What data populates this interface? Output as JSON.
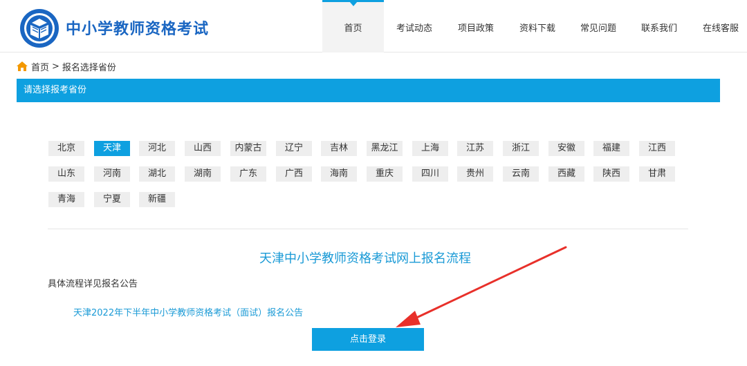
{
  "header": {
    "site_title": "中小学教师资格考试",
    "logo_icon": "education-book-seal-icon",
    "nav": [
      {
        "label": "首页",
        "active": true
      },
      {
        "label": "考试动态"
      },
      {
        "label": "项目政策"
      },
      {
        "label": "资料下载"
      },
      {
        "label": "常见问题"
      },
      {
        "label": "联系我们"
      },
      {
        "label": "在线客服"
      }
    ]
  },
  "breadcrumb": {
    "icon": "home-icon",
    "home": "首页",
    "separator": ">",
    "current": "报名选择省份"
  },
  "section_bar": {
    "title": "请选择报考省份"
  },
  "provinces": [
    "北京",
    "天津",
    "河北",
    "山西",
    "内蒙古",
    "辽宁",
    "吉林",
    "黑龙江",
    "上海",
    "江苏",
    "浙江",
    "安徽",
    "福建",
    "江西",
    "山东",
    "河南",
    "湖北",
    "湖南",
    "广东",
    "广西",
    "海南",
    "重庆",
    "四川",
    "贵州",
    "云南",
    "西藏",
    "陕西",
    "甘肃",
    "青海",
    "宁夏",
    "新疆"
  ],
  "selected_province": "天津",
  "content": {
    "flow_title": "天津中小学教师资格考试网上报名流程",
    "detail_label": "具体流程详见报名公告",
    "notice_link": "天津2022年下半年中小学教师资格考试（面试）报名公告",
    "login_button": "点击登录"
  },
  "colors": {
    "accent": "#0ea0e0",
    "title_blue": "#1a66c2",
    "annotation_arrow": "#e8302a"
  }
}
